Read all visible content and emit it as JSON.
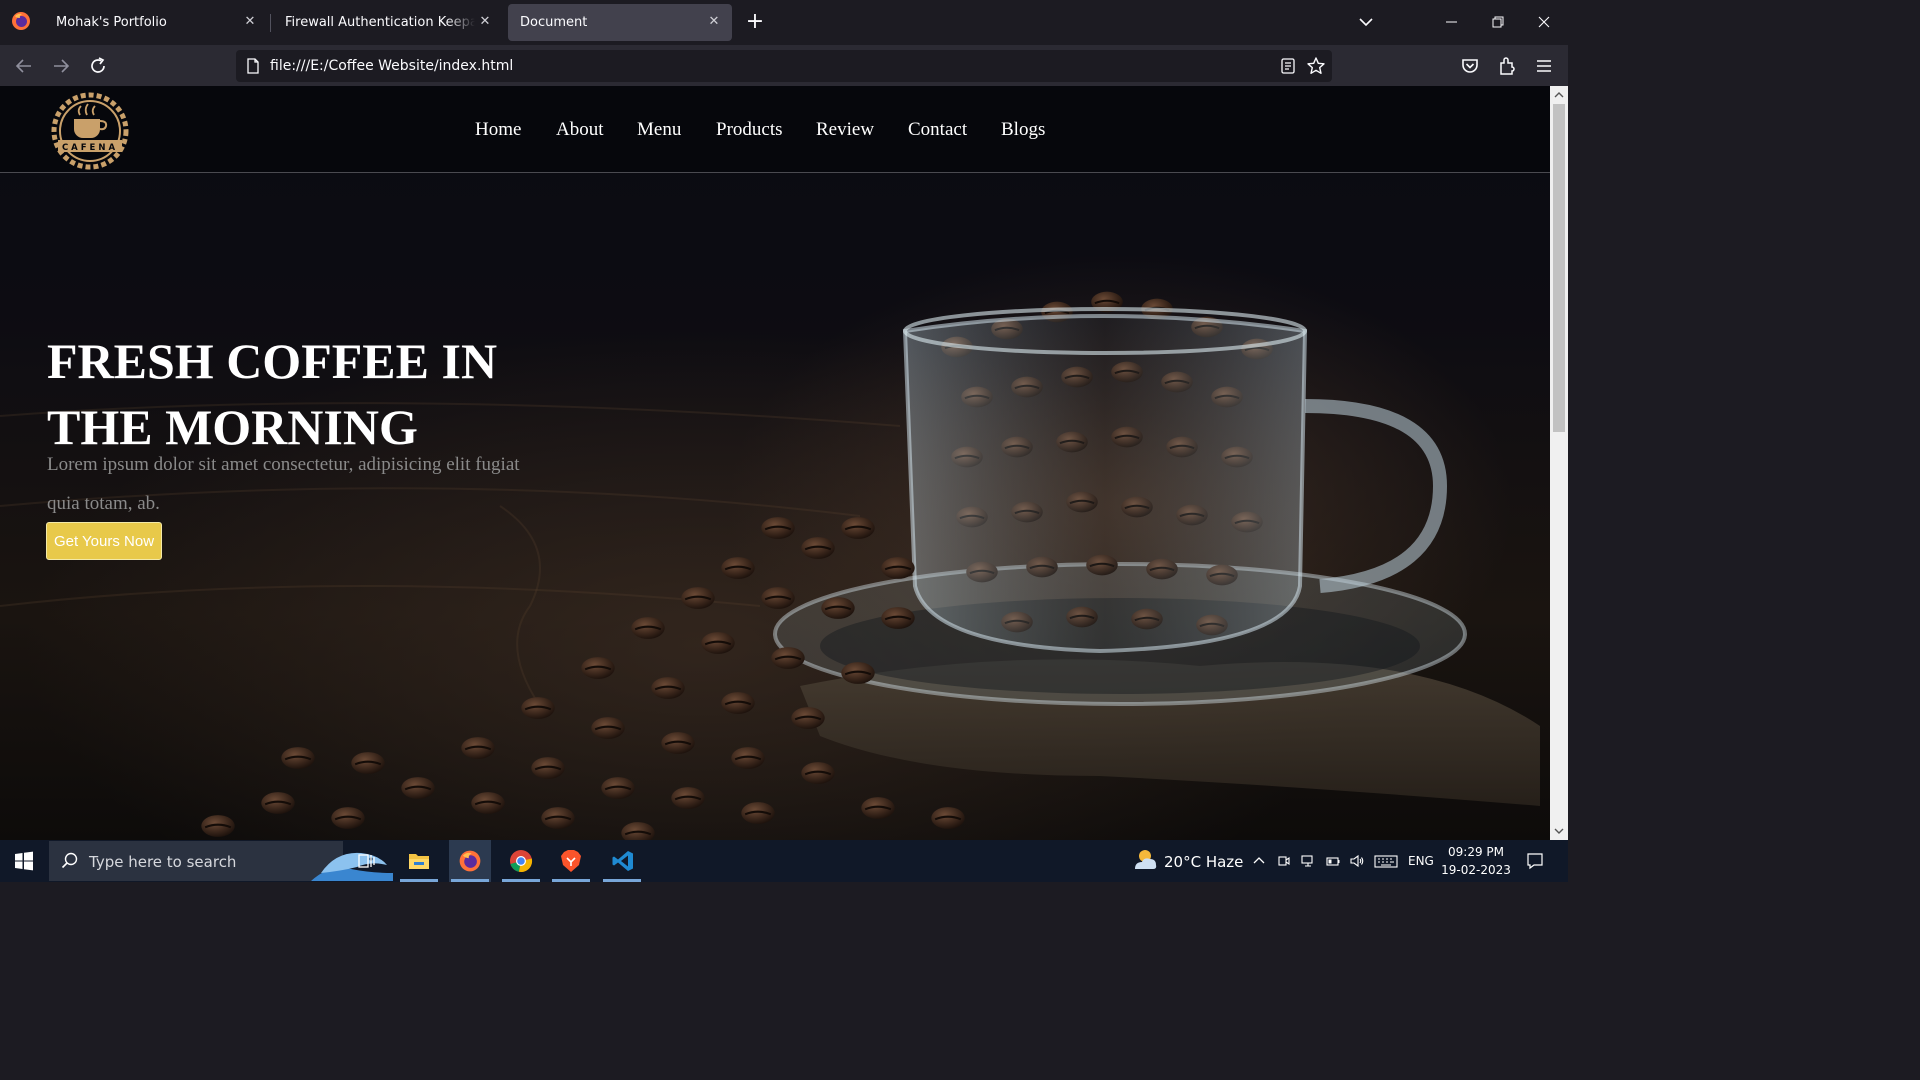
{
  "browser": {
    "tabs": [
      {
        "title": "Mohak's Portfolio",
        "active": false
      },
      {
        "title": "Firewall Authentication Keepalive Window",
        "active": false
      },
      {
        "title": "Document",
        "active": true
      }
    ],
    "url": "file:///E:/Coffee Website/index.html",
    "new_tab_glyph": "+",
    "close_glyph": "✕"
  },
  "site": {
    "logo_text": "CAFENA",
    "nav": [
      "Home",
      "About",
      "Menu",
      "Products",
      "Review",
      "Contact",
      "Blogs"
    ],
    "hero": {
      "title": "FRESH COFFEE IN THE MORNING",
      "text": "Lorem ipsum dolor sit amet consectetur, adipisicing elit fugiat quia totam, ab.",
      "cta": "Get Yours Now"
    }
  },
  "taskbar": {
    "search_placeholder": "Type here to search",
    "apps": [
      "task-view",
      "file-explorer",
      "firefox",
      "chrome",
      "brave",
      "vscode"
    ],
    "weather": "20°C  Haze",
    "language": "ENG",
    "time": "09:29 PM",
    "date": "19-02-2023"
  },
  "colors": {
    "accent": "#e8c94a",
    "tab_active": "#42414d",
    "chrome_dark": "#1c1b22",
    "taskbar": "#101828"
  }
}
